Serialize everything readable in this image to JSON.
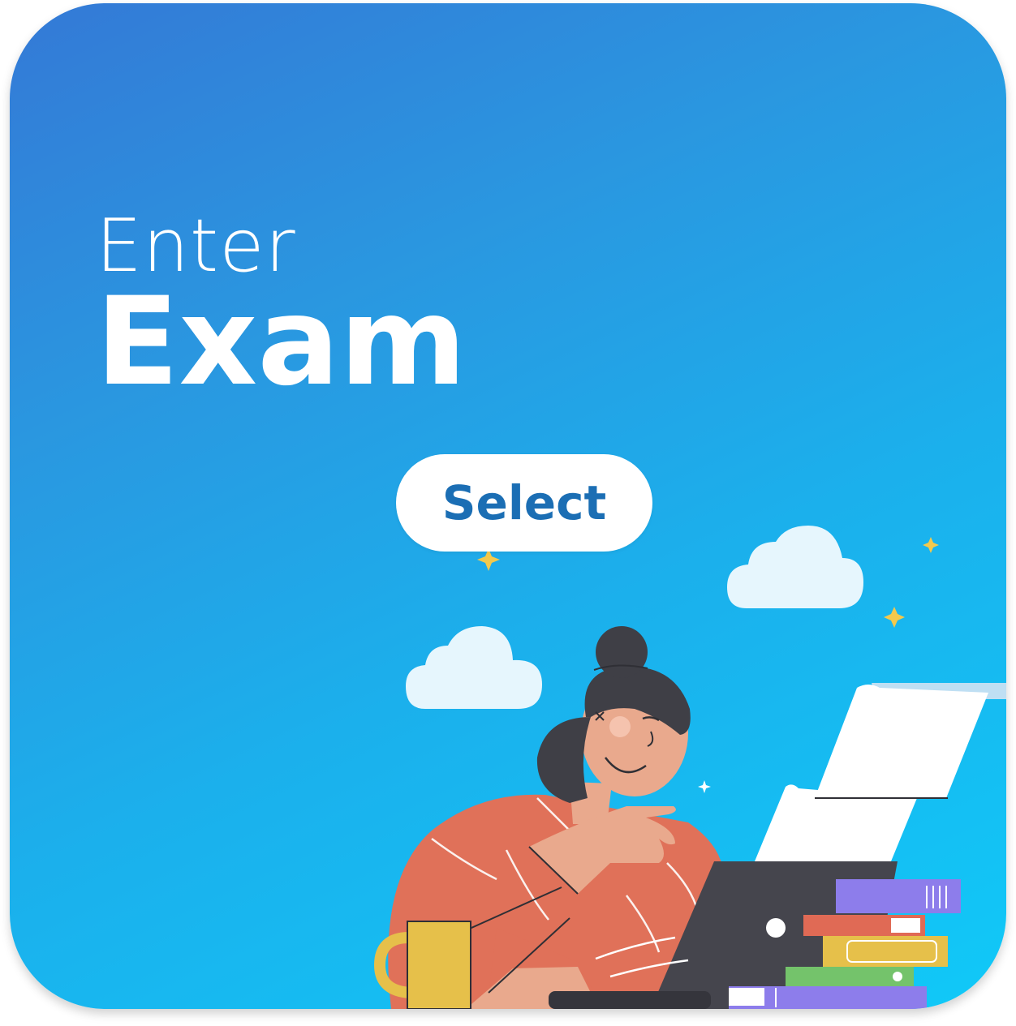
{
  "card": {
    "heading_line1": "Enter",
    "heading_line2": "Exam",
    "button_label": "Select"
  },
  "illustration": {
    "subject": "woman-studying-at-laptop-icon",
    "colors": {
      "sweater": "#e07159",
      "skin": "#e9a98d",
      "hair": "#3f3f46",
      "laptop": "#45454d",
      "mug": "#e6c04a",
      "book_purple": "#8d7deb",
      "book_red": "#e06a55",
      "book_yellow": "#e6c04a",
      "book_green": "#74c36b",
      "cloud": "#e6f6fd",
      "sparkle": "#f3c94c"
    }
  },
  "theme": {
    "gradient_start": "#3479d6",
    "gradient_end": "#10c9f8",
    "button_text_color": "#1b6eb4"
  }
}
